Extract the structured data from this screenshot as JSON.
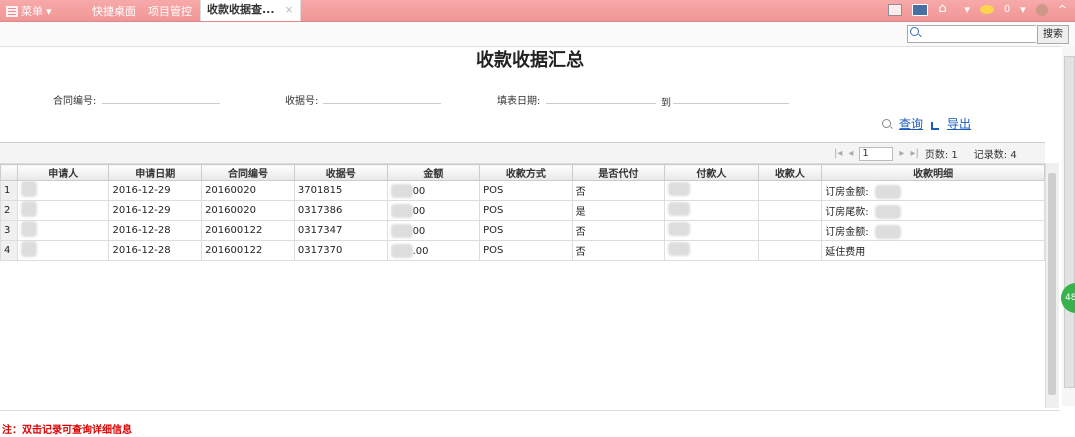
{
  "topbar": {
    "menu_label": "菜单",
    "tabs": [
      "快捷桌面",
      "项目管控",
      "收款收据查..."
    ],
    "close_glyph": "×",
    "notif_count": "0"
  },
  "search": {
    "placeholder": "",
    "button": "搜索"
  },
  "page_title": "收款收据汇总",
  "filters": {
    "contract_label": "合同编号:",
    "receipt_label": "收据号:",
    "date_label": "填表日期:",
    "date_to": "到"
  },
  "actions": {
    "query": "查询",
    "export": "导出"
  },
  "pager": {
    "page_value": "1",
    "pages_label": "页数:",
    "pages_value": "1",
    "records_label": "记录数:",
    "records_value": "4"
  },
  "table": {
    "headers": [
      "",
      "申请人",
      "申请日期",
      "合同编号",
      "收据号",
      "金额",
      "收款方式",
      "是否代付",
      "付款人",
      "收款人",
      "收款明细"
    ],
    "rows": [
      {
        "n": "1",
        "date": "2016-12-29",
        "contract": "20160020",
        "receipt": "3701815",
        "amount": "00",
        "method": "POS",
        "proxy": "否",
        "detail": "订房金额:"
      },
      {
        "n": "2",
        "date": "2016-12-29",
        "contract": "20160020",
        "receipt": "0317386",
        "amount": "00",
        "method": "POS",
        "proxy": "是",
        "detail": "订房尾款:"
      },
      {
        "n": "3",
        "date": "2016-12-28",
        "contract": "201600122",
        "receipt": "0317347",
        "amount": "00",
        "method": "POS",
        "proxy": "否",
        "detail": "订房金额:"
      },
      {
        "n": "4",
        "date": "2016-12-28",
        "contract": "201600122",
        "receipt": "0317370",
        "amount": ".00",
        "method": "POS",
        "proxy": "否",
        "detail": "延住费用"
      }
    ]
  },
  "note": "注：双击记录可查询详细信息",
  "bubble": "48",
  "colors": {
    "topbar": "#f19696",
    "link": "#1a5bbd",
    "note": "#dd0000"
  }
}
